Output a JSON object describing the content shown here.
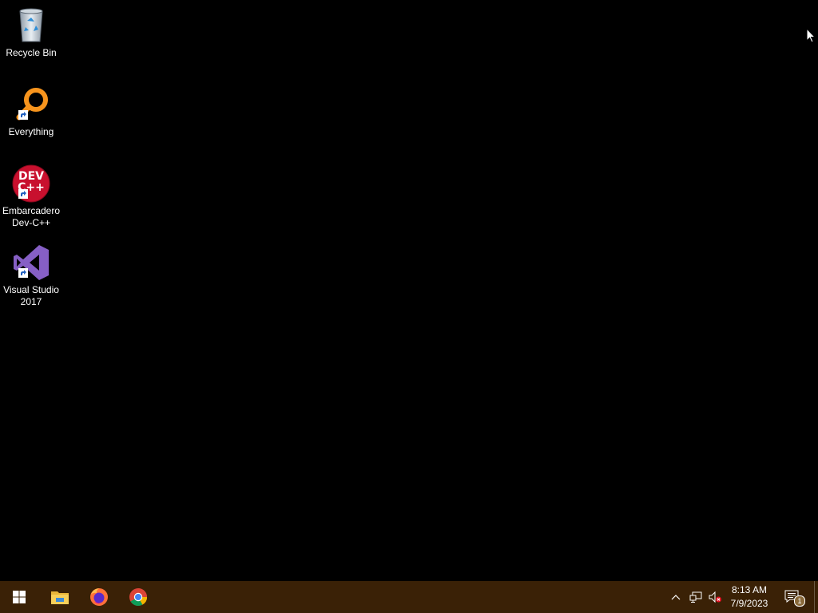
{
  "desktop": {
    "icons": [
      {
        "label": "Recycle Bin",
        "icon": "recycle-bin-icon"
      },
      {
        "label": "Everything",
        "icon": "everything-search-icon"
      },
      {
        "label": "Embarcadero Dev-C++",
        "icon": "devcpp-icon",
        "badge": "DEV C++"
      },
      {
        "label": "Visual Studio 2017",
        "icon": "visual-studio-icon"
      }
    ]
  },
  "taskbar": {
    "pinned": [
      {
        "name": "Start",
        "icon": "windows-logo-icon"
      },
      {
        "name": "File Explorer",
        "icon": "folder-icon"
      },
      {
        "name": "Firefox",
        "icon": "firefox-icon"
      },
      {
        "name": "Chrome",
        "icon": "chrome-icon"
      }
    ],
    "tray": {
      "time": "8:13 AM",
      "date": "7/9/2023",
      "notification_count": "1"
    }
  },
  "colors": {
    "taskbar": "#3a2106",
    "desktop": "#000000",
    "vs_purple": "#865fc5",
    "devcpp_red": "#c8102e",
    "everything_orange": "#f7941d"
  }
}
